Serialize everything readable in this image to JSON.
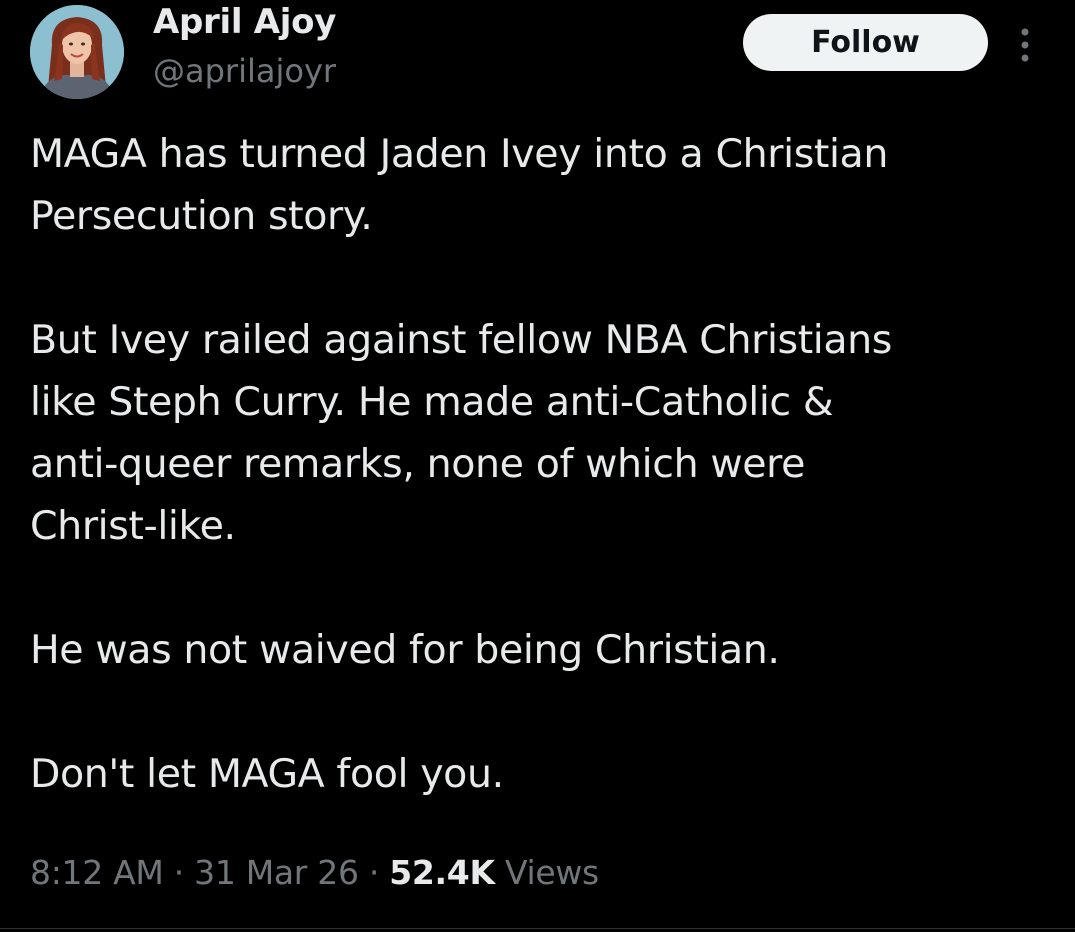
{
  "author": {
    "name": "April Ajoy",
    "handle": "@aprilajoyr",
    "avatar_icon": "profile-photo-icon"
  },
  "actions": {
    "follow_label": "Follow",
    "more_icon": "more-vertical-icon"
  },
  "tweet": {
    "paragraphs": [
      "MAGA has turned Jaden Ivey into a Christian\nPersecution story.",
      "But Ivey railed against fellow NBA Christians\nlike Steph Curry. He made anti-Catholic &\nanti-queer remarks, none of which were\nChrist-like.",
      "He was not waived for being Christian.",
      "Don't let MAGA fool you."
    ]
  },
  "meta": {
    "time": "8:12 AM",
    "separator": " · ",
    "date": "31 Mar 26",
    "views_count": "52.4K",
    "views_label": "Views"
  },
  "colors": {
    "background": "#000000",
    "primary_text": "#e7e9ea",
    "secondary_text": "#71767b",
    "follow_button_bg": "#eff3f4",
    "follow_button_text": "#0f1419"
  }
}
